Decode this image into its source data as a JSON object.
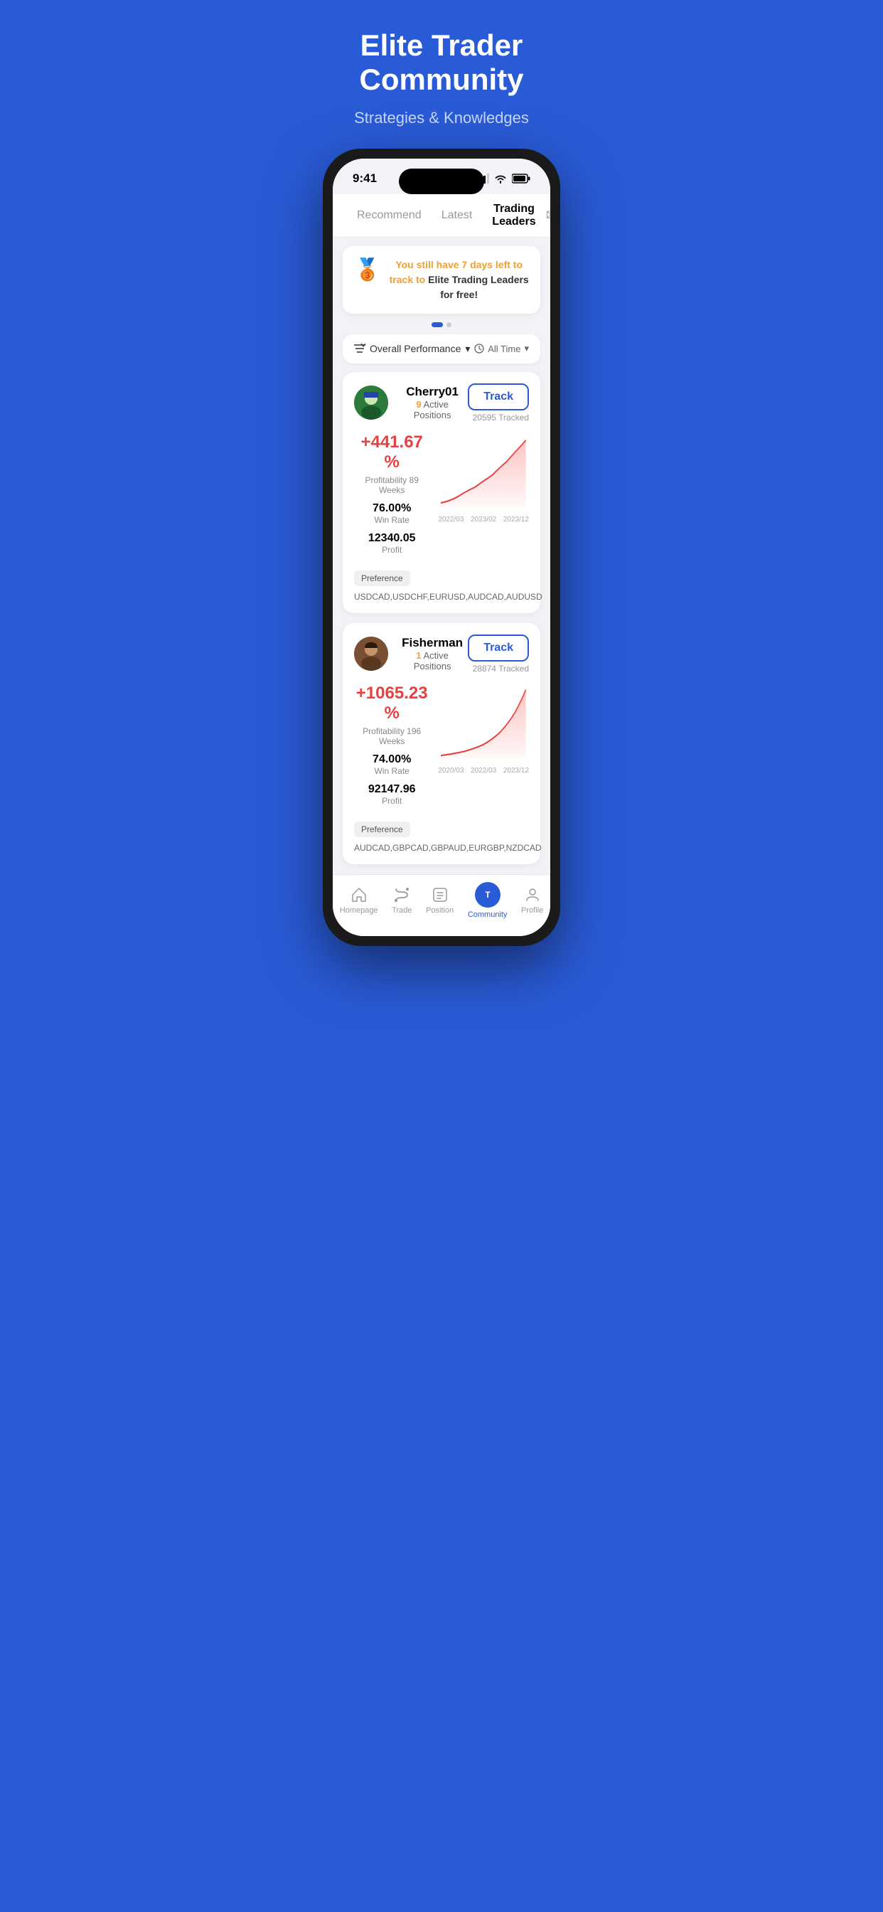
{
  "hero": {
    "title": "Elite Trader Community",
    "subtitle": "Strategies & Knowledges"
  },
  "statusBar": {
    "time": "9:41",
    "signal": "signal-icon",
    "wifi": "wifi-icon",
    "battery": "battery-icon"
  },
  "topTabs": {
    "items": [
      {
        "label": "Recommend",
        "active": false
      },
      {
        "label": "Latest",
        "active": false
      },
      {
        "label": "Trading Leaders",
        "active": true
      }
    ],
    "mailIcon": "✉"
  },
  "promoBanner": {
    "icon": "🥉",
    "textPart1": "You still have 7 days left to track to ",
    "textHighlight": "Elite Trading Leaders for free!"
  },
  "filterRow": {
    "sortLabel": "Overall Performance",
    "sortIcon": "↓",
    "timeLabel": "All Time",
    "timeIcon": "🕐"
  },
  "traders": [
    {
      "id": "cherry01",
      "name": "Cherry01",
      "activePositions": 9,
      "trackLabel": "Track",
      "trackedCount": "20595 Tracked",
      "profitPct": "+441.67 %",
      "profitabilityLabel": "Profitability",
      "profitabilityWeeks": "89 Weeks",
      "winRate": "76.00%",
      "winRateLabel": "Win Rate",
      "profit": "12340.05",
      "profitLabel": "Profit",
      "preferenceLabel": "Preference",
      "preferencePairs": "USDCAD,USDCHF,EURUSD,AUDCAD,AUDUSD",
      "chartLabels": [
        "2022/03",
        "2023/02",
        "2023/12"
      ]
    },
    {
      "id": "fisherman",
      "name": "Fisherman",
      "activePositions": 1,
      "trackLabel": "Track",
      "trackedCount": "28874 Tracked",
      "profitPct": "+1065.23 %",
      "profitabilityLabel": "Profitability",
      "profitabilityWeeks": "196 Weeks",
      "winRate": "74.00%",
      "winRateLabel": "Win Rate",
      "profit": "92147.96",
      "profitLabel": "Profit",
      "preferenceLabel": "Preference",
      "preferencePairs": "AUDCAD,GBPCAD,GBPAUD,EURGBP,NZDCAD",
      "chartLabels": [
        "2020/03",
        "2022/03",
        "2023/12"
      ]
    }
  ],
  "bottomNav": {
    "items": [
      {
        "label": "Homepage",
        "icon": "home",
        "active": false
      },
      {
        "label": "Trade",
        "icon": "trade",
        "active": false
      },
      {
        "label": "Position",
        "icon": "position",
        "active": false
      },
      {
        "label": "Community",
        "icon": "community",
        "active": true
      },
      {
        "label": "Profile",
        "icon": "profile",
        "active": false
      }
    ]
  }
}
